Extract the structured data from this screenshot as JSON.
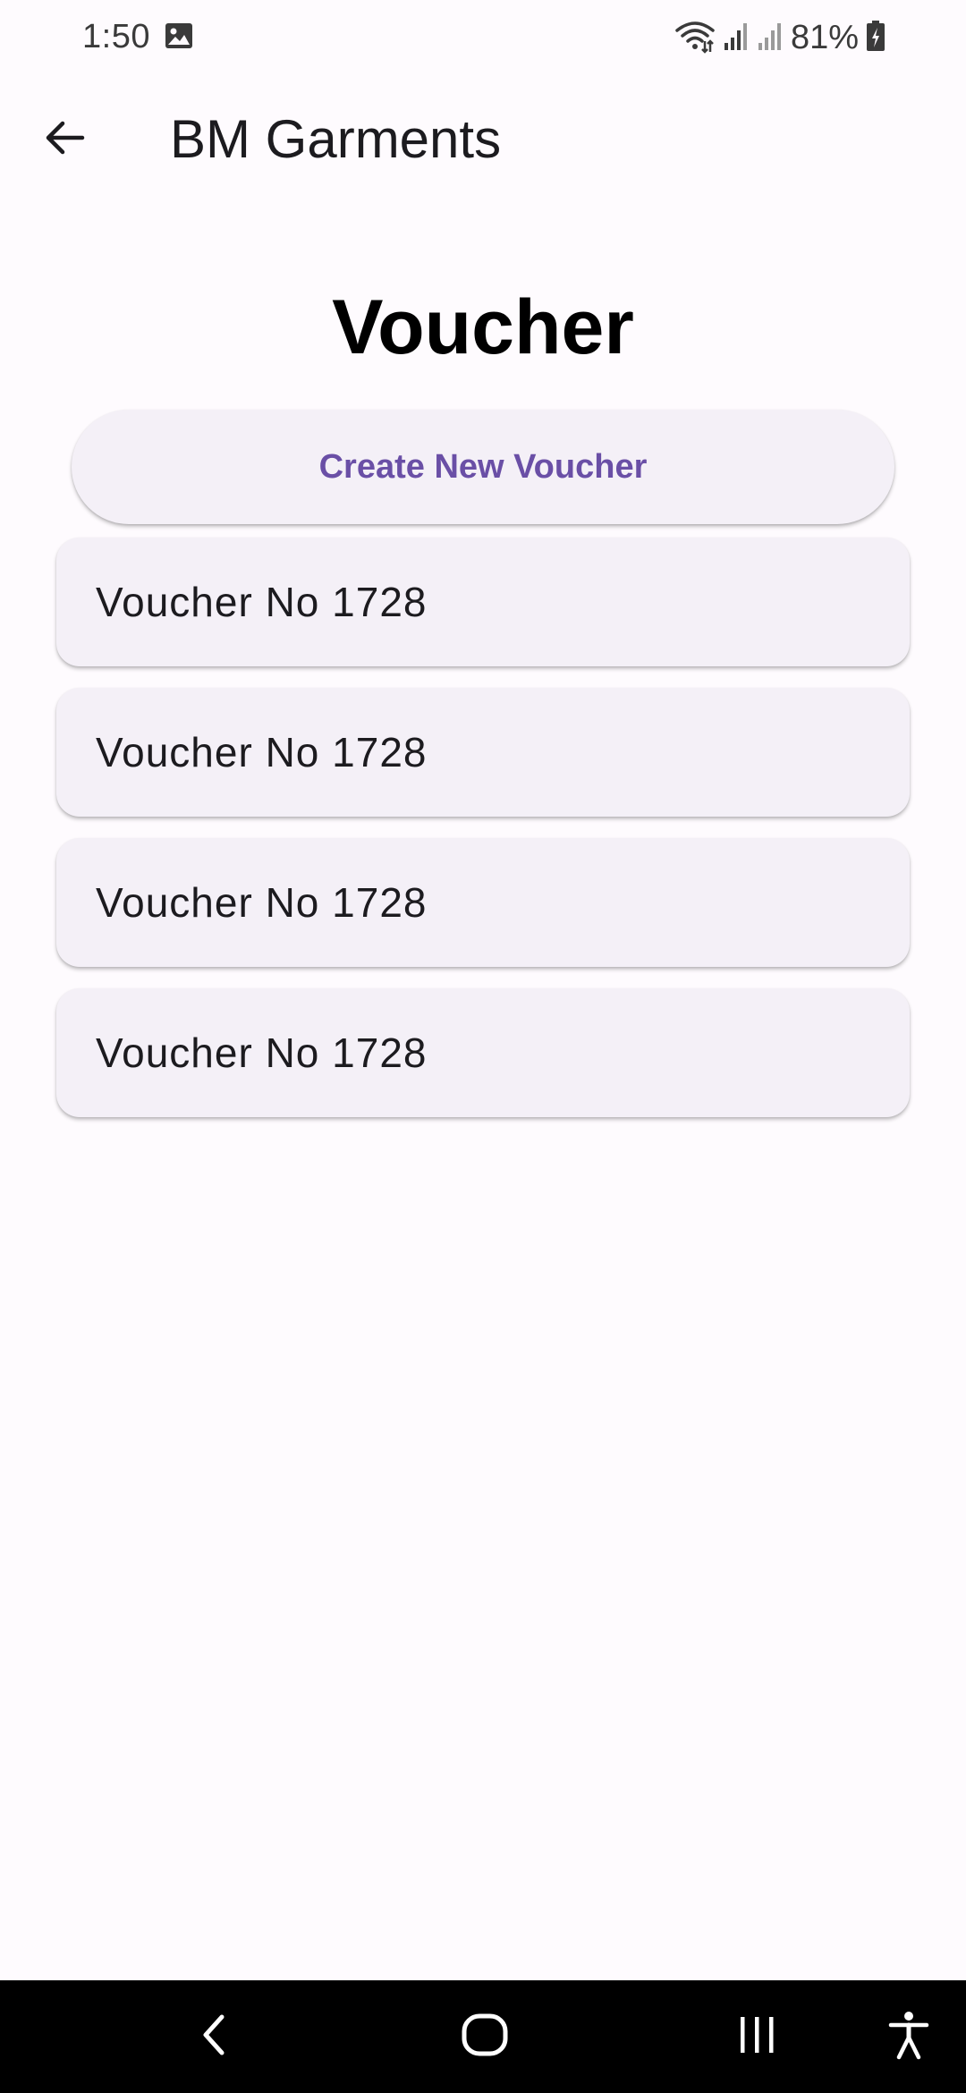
{
  "status_bar": {
    "time": "1:50",
    "battery": "81%",
    "icons": [
      "image-icon",
      "wifi-icon",
      "signal-icon",
      "signal-icon",
      "battery-charging-icon"
    ]
  },
  "app_bar": {
    "title": "BM Garments",
    "back_icon": "arrow-back-icon"
  },
  "main": {
    "heading": "Voucher",
    "create_button_label": "Create New Voucher",
    "vouchers": [
      {
        "label": "Voucher No 1728"
      },
      {
        "label": "Voucher No 1728"
      },
      {
        "label": "Voucher No 1728"
      },
      {
        "label": "Voucher No 1728"
      }
    ]
  },
  "navigation_bar": {
    "icons": [
      "nav-back-icon",
      "nav-home-icon",
      "nav-recents-icon",
      "accessibility-icon"
    ]
  },
  "colors": {
    "background": "#fefbfe",
    "card": "#f4f0f7",
    "accent": "#6a4fa6",
    "text": "#1c1b1f"
  }
}
